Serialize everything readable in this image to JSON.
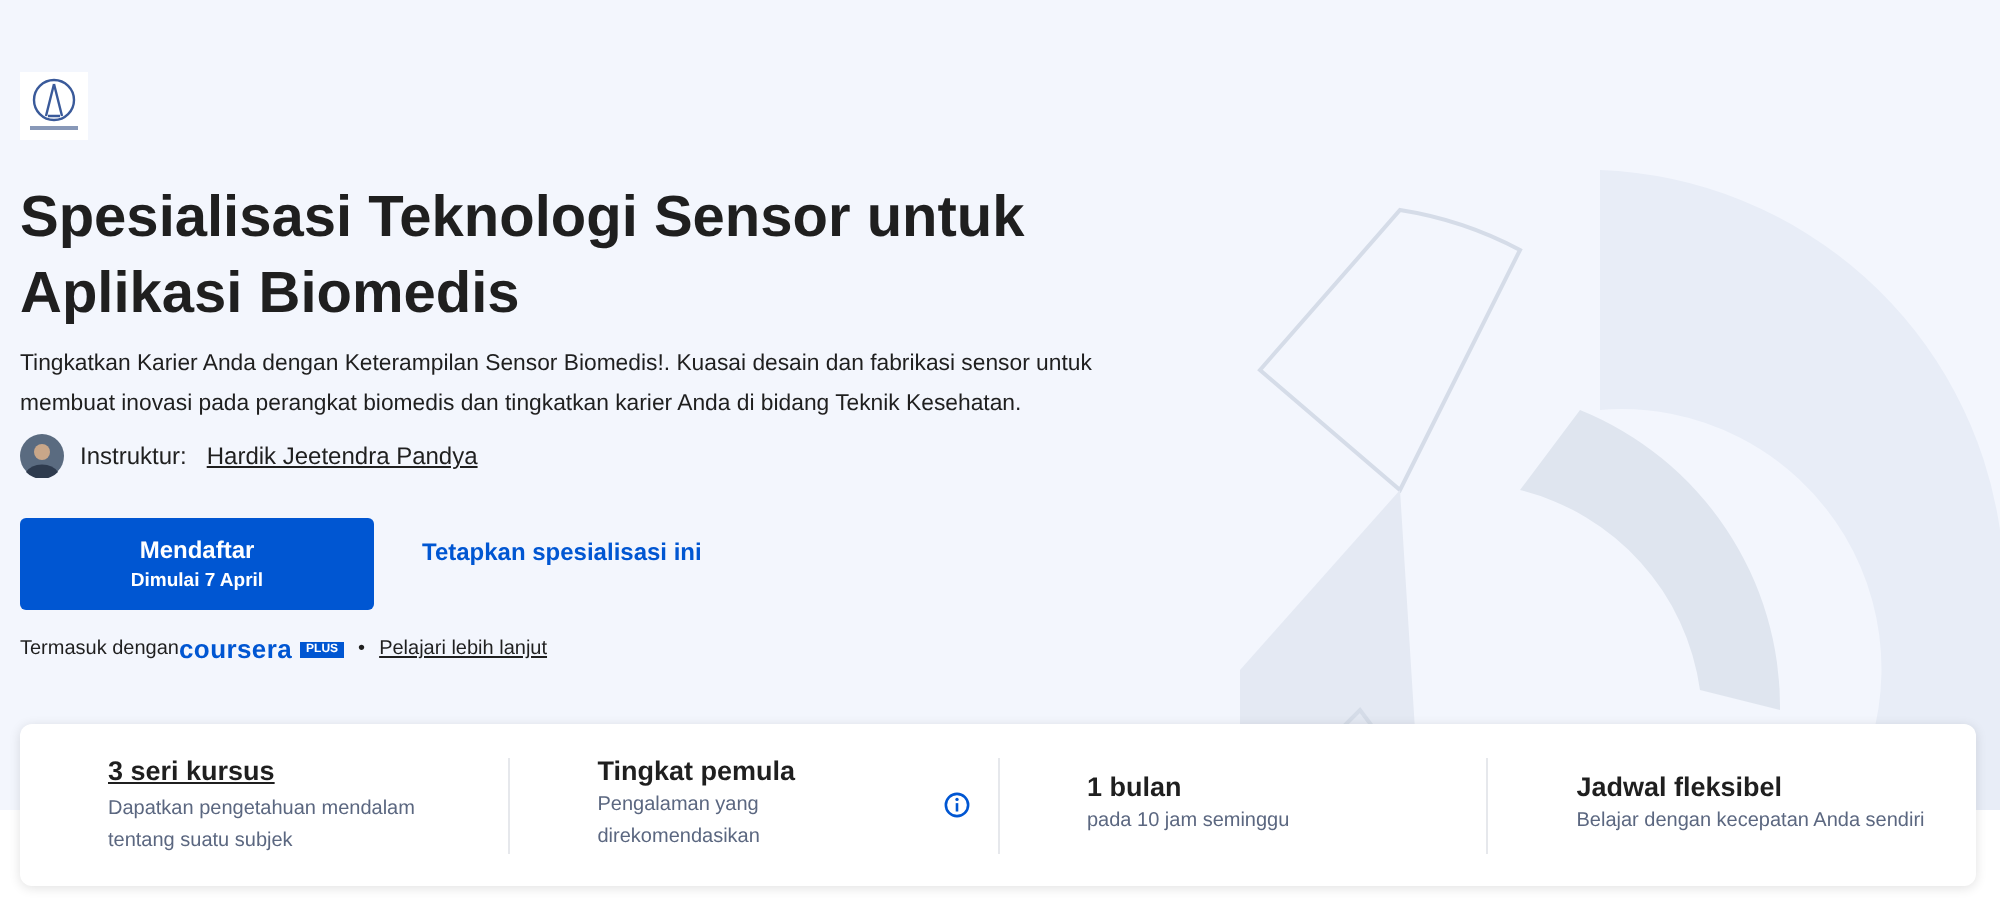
{
  "title": "Spesialisasi Teknologi Sensor untuk Aplikasi Biomedis",
  "description": "Tingkatkan Karier Anda dengan Keterampilan Sensor Biomedis!. Kuasai desain dan fabrikasi sensor untuk membuat inovasi pada perangkat biomedis dan tingkatkan karier Anda di bidang Teknik Kesehatan.",
  "instructor": {
    "label": "Instruktur:",
    "name": "Hardik Jeetendra Pandya"
  },
  "enroll_button": {
    "label": "Mendaftar",
    "sublabel": "Dimulai 7 April"
  },
  "save_link": "Tetapkan spesialisasi ini",
  "included": {
    "text": "Termasuk dengan",
    "brand": "coursera",
    "badge": "PLUS",
    "separator": "•",
    "link": "Pelajari lebih lanjut"
  },
  "stats": [
    {
      "title": "3 seri kursus",
      "subtitle": "Dapatkan pengetahuan mendalam tentang suatu subjek",
      "link": true,
      "info": false
    },
    {
      "title": "Tingkat pemula",
      "subtitle": "Pengalaman yang direkomendasikan",
      "link": false,
      "info": true
    },
    {
      "title": "1 bulan",
      "subtitle": "pada 10 jam seminggu",
      "link": false,
      "info": false
    },
    {
      "title": "Jadwal fleksibel",
      "subtitle": "Belajar dengan kecepatan Anda sendiri",
      "link": false,
      "info": false
    }
  ]
}
